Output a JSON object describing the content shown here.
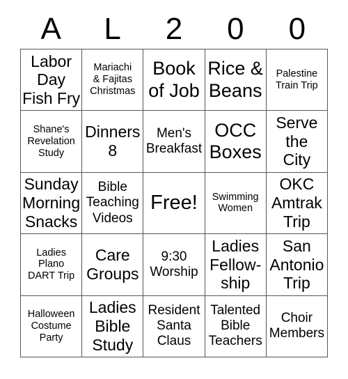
{
  "card": {
    "header_letters": [
      "A",
      "L",
      "2",
      "0",
      "0"
    ],
    "free_space_label": "Free!",
    "rows": [
      [
        {
          "text": "Labor\nDay\nFish Fry",
          "size": "lg"
        },
        {
          "text": "Mariachi\n& Fajitas\nChristmas",
          "size": "sm"
        },
        {
          "text": "Book\nof Job",
          "size": "xl"
        },
        {
          "text": "Rice &\nBeans",
          "size": "xl"
        },
        {
          "text": "Palestine\nTrain Trip",
          "size": "sm"
        }
      ],
      [
        {
          "text": "Shane's\nRevelation\nStudy",
          "size": "sm"
        },
        {
          "text": "Dinners\n8",
          "size": "lg"
        },
        {
          "text": "Men's\nBreakfast",
          "size": "md"
        },
        {
          "text": "OCC\nBoxes",
          "size": "xl"
        },
        {
          "text": "Serve\nthe\nCity",
          "size": "lg"
        }
      ],
      [
        {
          "text": "Sunday\nMorning\nSnacks",
          "size": "lg"
        },
        {
          "text": "Bible\nTeaching\nVideos",
          "size": "md"
        },
        {
          "text": "Free!",
          "size": "free"
        },
        {
          "text": "Swimming\nWomen",
          "size": "sm"
        },
        {
          "text": "OKC\nAmtrak\nTrip",
          "size": "lg"
        }
      ],
      [
        {
          "text": "Ladies\nPlano\nDART Trip",
          "size": "sm"
        },
        {
          "text": "Care\nGroups",
          "size": "lg"
        },
        {
          "text": "9:30\nWorship",
          "size": "md"
        },
        {
          "text": "Ladies\nFellow-\nship",
          "size": "lg"
        },
        {
          "text": "San\nAntonio\nTrip",
          "size": "lg"
        }
      ],
      [
        {
          "text": "Halloween\nCostume\nParty",
          "size": "sm"
        },
        {
          "text": "Ladies\nBible\nStudy",
          "size": "lg"
        },
        {
          "text": "Resident\nSanta\nClaus",
          "size": "md"
        },
        {
          "text": "Talented\nBible\nTeachers",
          "size": "md"
        },
        {
          "text": "Choir\nMembers",
          "size": "md"
        }
      ]
    ]
  },
  "colors": {
    "background": "#ffffff",
    "text": "#000000",
    "grid_line": "#555555"
  }
}
